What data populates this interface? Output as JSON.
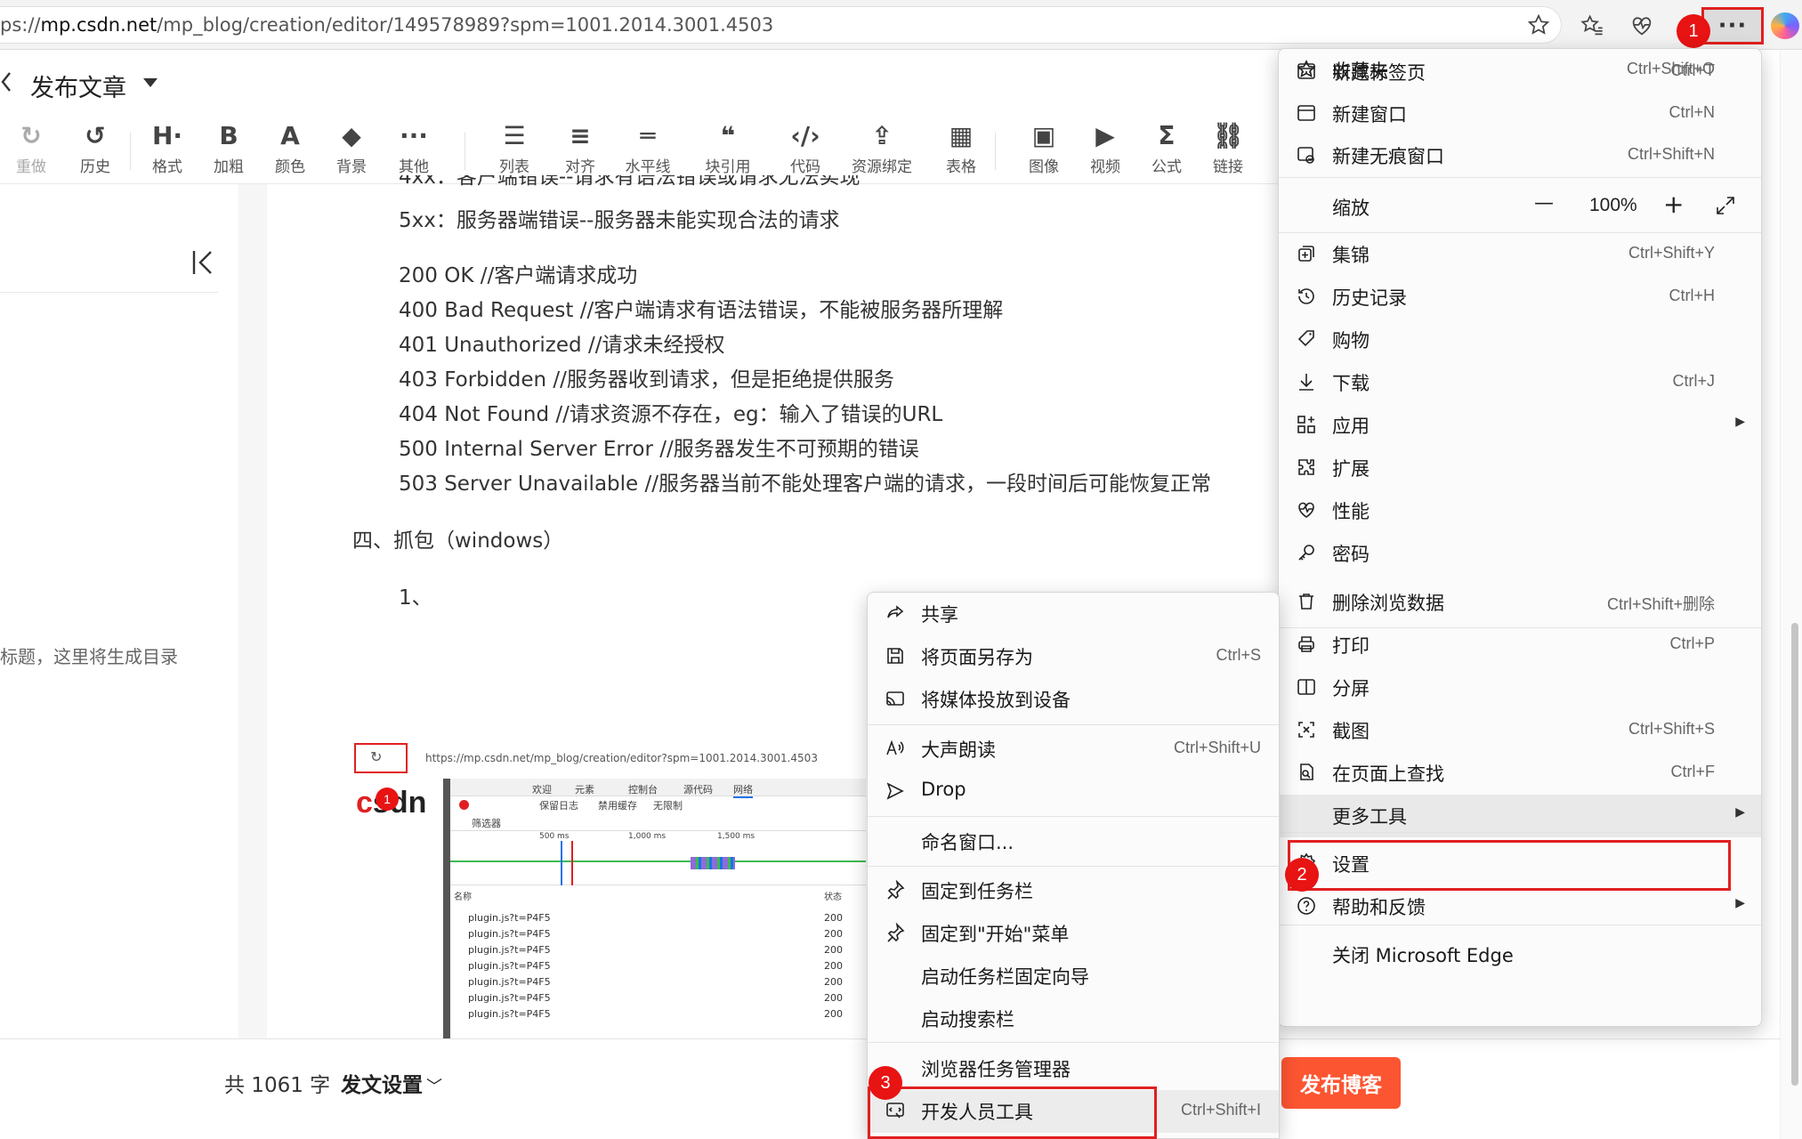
{
  "browser": {
    "url_prefix": "ps://",
    "url_host": "mp.csdn.net",
    "url_path": "/mp_blog/creation/editor/149578989?spm=1001.2014.3001.4503",
    "more_label": "···",
    "badge1": "1"
  },
  "editor": {
    "title": "发布文章",
    "toolbar": [
      {
        "icon": "redo-icon",
        "glyph": "↻",
        "label": "重做",
        "dim": true
      },
      {
        "icon": "history-icon",
        "glyph": "↺",
        "label": "历史"
      },
      {
        "icon": "heading-icon",
        "glyph": "H·",
        "label": "格式"
      },
      {
        "icon": "bold-icon",
        "glyph": "B",
        "label": "加粗"
      },
      {
        "icon": "color-icon",
        "glyph": "A",
        "label": "颜色"
      },
      {
        "icon": "paint-bucket-icon",
        "glyph": "◆",
        "label": "背景"
      },
      {
        "icon": "more-dots-icon",
        "glyph": "···",
        "label": "其他"
      },
      {
        "icon": "list-icon",
        "glyph": "☰",
        "label": "列表"
      },
      {
        "icon": "align-icon",
        "glyph": "≡",
        "label": "对齐"
      },
      {
        "icon": "horizontal-rule-icon",
        "glyph": "═",
        "label": "水平线"
      },
      {
        "icon": "quote-icon",
        "glyph": "❝",
        "label": "块引用"
      },
      {
        "icon": "code-icon",
        "glyph": "‹/›",
        "label": "代码"
      },
      {
        "icon": "resource-bind-icon",
        "glyph": "⇪",
        "label": "资源绑定"
      },
      {
        "icon": "table-icon",
        "glyph": "▦",
        "label": "表格"
      },
      {
        "icon": "image-icon",
        "glyph": "▣",
        "label": "图像"
      },
      {
        "icon": "video-icon",
        "glyph": "▶",
        "label": "视频"
      },
      {
        "icon": "formula-icon",
        "glyph": "Σ",
        "label": "公式"
      },
      {
        "icon": "link-icon",
        "glyph": "⛓",
        "label": "链接"
      }
    ],
    "toc_placeholder": "标题，这里将生成目录",
    "lines": [
      "5xx：服务器端错误--服务器未能实现合法的请求",
      "200 OK      //客户端请求成功",
      "400 Bad Request  //客户端请求有语法错误，不能被服务器所理解",
      "401 Unauthorized //请求未经授权",
      "403 Forbidden  //服务器收到请求，但是拒绝提供服务",
      "404 Not Found  //请求资源不存在，eg：输入了错误的URL",
      "500 Internal Server Error //服务器发生不可预期的错误",
      "503 Server Unavailable //服务器当前不能处理客户端的请求，一段时间后可能恢复正常"
    ],
    "heading4": "四、抓包（windows）",
    "item1": "1、",
    "word_count": "共 1061 字",
    "publish_settings": "发文设置",
    "publish_button": "发布博客"
  },
  "embedded_screenshot": {
    "url": "https://mp.csdn.net/mp_blog/creation/editor?spm=1001.2014.3001.4503",
    "logo_c": "c",
    "logo_rest": "sdn",
    "badge": "1",
    "tabs": [
      "欢迎",
      "元素",
      "控制台",
      "源代码",
      "网络"
    ],
    "filter_row": [
      "保留日志",
      "禁用缓存",
      "无限制"
    ],
    "filter_label": "筛选器",
    "timeline_ticks": [
      "500 ms",
      "1,000 ms",
      "1,500 ms"
    ],
    "col_name": "名称",
    "col_status": "状态",
    "rows": [
      "plugin.js?t=P4F5",
      "plugin.js?t=P4F5",
      "plugin.js?t=P4F5",
      "plugin.js?t=P4F5",
      "plugin.js?t=P4F5",
      "plugin.js?t=P4F5",
      "plugin.js?t=P4F5"
    ],
    "status": [
      "200",
      "200",
      "200",
      "200",
      "200",
      "200",
      "200"
    ]
  },
  "main_menu": {
    "items": [
      {
        "icon": "new-tab-icon",
        "label": "新建标签页",
        "shortcut": "Ctrl+T"
      },
      {
        "icon": "new-window-icon",
        "label": "新建窗口",
        "shortcut": "Ctrl+N"
      },
      {
        "icon": "inprivate-window-icon",
        "label": "新建无痕窗口",
        "shortcut": "Ctrl+Shift+N"
      },
      {
        "icon": "star-icon",
        "label": "收藏夹",
        "shortcut": "Ctrl+Shift+O"
      },
      {
        "icon": "collections-icon",
        "label": "集锦",
        "shortcut": "Ctrl+Shift+Y"
      },
      {
        "icon": "history-icon",
        "label": "历史记录",
        "shortcut": "Ctrl+H"
      },
      {
        "icon": "shopping-tag-icon",
        "label": "购物",
        "shortcut": ""
      },
      {
        "icon": "download-icon",
        "label": "下载",
        "shortcut": "Ctrl+J"
      },
      {
        "icon": "apps-icon",
        "label": "应用",
        "shortcut": ""
      },
      {
        "icon": "extensions-icon",
        "label": "扩展",
        "shortcut": ""
      },
      {
        "icon": "performance-icon",
        "label": "性能",
        "shortcut": ""
      },
      {
        "icon": "key-icon",
        "label": "密码",
        "shortcut": ""
      },
      {
        "icon": "trash-icon",
        "label": "删除浏览数据",
        "shortcut": "Ctrl+Shift+删除"
      },
      {
        "icon": "print-icon",
        "label": "打印",
        "shortcut": "Ctrl+P"
      },
      {
        "icon": "split-screen-icon",
        "label": "分屏",
        "shortcut": ""
      },
      {
        "icon": "screenshot-icon",
        "label": "截图",
        "shortcut": "Ctrl+Shift+S"
      },
      {
        "icon": "find-in-page-icon",
        "label": "在页面上查找",
        "shortcut": "Ctrl+F"
      },
      {
        "icon": "",
        "label": "更多工具",
        "shortcut": ""
      },
      {
        "icon": "settings-icon",
        "label": "设置",
        "shortcut": ""
      },
      {
        "icon": "help-icon",
        "label": "帮助和反馈",
        "shortcut": ""
      },
      {
        "icon": "",
        "label": "关闭 Microsoft Edge",
        "shortcut": ""
      }
    ],
    "zoom_label": "缩放",
    "zoom_value": "100%",
    "zoom_minus": "—",
    "zoom_plus": "+",
    "badge2": "2"
  },
  "sub_menu": {
    "items": [
      {
        "icon": "share-icon",
        "label": "共享",
        "shortcut": ""
      },
      {
        "icon": "save-page-icon",
        "label": "将页面另存为",
        "shortcut": "Ctrl+S"
      },
      {
        "icon": "cast-icon",
        "label": "将媒体投放到设备",
        "shortcut": ""
      },
      {
        "icon": "read-aloud-icon",
        "label": "大声朗读",
        "shortcut": "Ctrl+Shift+U"
      },
      {
        "icon": "drop-icon",
        "label": "Drop",
        "shortcut": ""
      },
      {
        "icon": "",
        "label": "命名窗口...",
        "shortcut": ""
      },
      {
        "icon": "pin-icon",
        "label": "固定到任务栏",
        "shortcut": ""
      },
      {
        "icon": "pin-icon",
        "label": "固定到\"开始\"菜单",
        "shortcut": ""
      },
      {
        "icon": "",
        "label": "启动任务栏固定向导",
        "shortcut": ""
      },
      {
        "icon": "",
        "label": "启动搜索栏",
        "shortcut": ""
      },
      {
        "icon": "",
        "label": "浏览器任务管理器",
        "shortcut": ""
      },
      {
        "icon": "devtools-icon",
        "label": "开发人员工具",
        "shortcut": "Ctrl+Shift+I"
      }
    ],
    "badge3": "3"
  },
  "colors": {
    "accent": "#fc5531",
    "annotation_red": "#e02020",
    "menu_bg": "#fbfbfb"
  }
}
